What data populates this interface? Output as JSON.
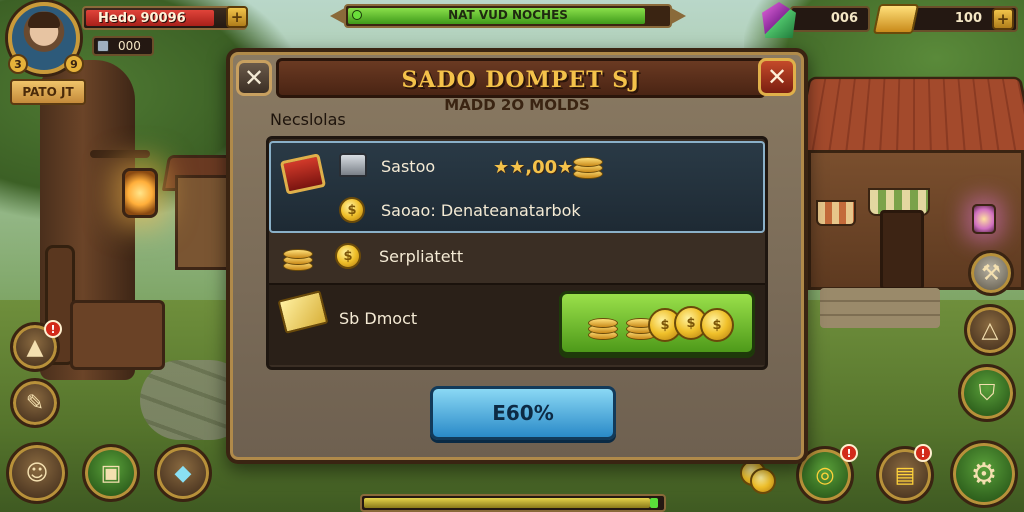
{
  "hud": {
    "player_name": "Hedo 90096",
    "player_bar_fill": 0.82,
    "player_level_left": "3",
    "player_level_right": "9",
    "gems_small": "000",
    "rank_label": "PATO JT",
    "title": "NAT VUD NOCHES",
    "title_progress": 0.93,
    "gems": "006",
    "gold": "100"
  },
  "modal": {
    "title": "SADO DOMPET SJ",
    "subtitle": "MADD 2O MOLDS",
    "section_label": "Necslolas",
    "rows": [
      {
        "name": "Sastoo",
        "price": "★★,00★"
      },
      {
        "name": "Saoao: Denateanatarbok"
      },
      {
        "name": "Serpliatett"
      },
      {
        "name": "Sb Dmoct"
      }
    ],
    "confirm_label": "E60%"
  },
  "bottom": {
    "progress": 0.96
  },
  "badges": {
    "quest_notif": "!",
    "inventory_notif": "!",
    "shop_notif": "!"
  },
  "colors": {
    "accent_gold": "#f4c24a",
    "buy_green": "#4e9a1a",
    "confirm_blue": "#2a8ac8",
    "close_red": "#c44a2a"
  },
  "icons": [
    "avatar",
    "gem-icon",
    "gold-bar-icon",
    "chest-icon",
    "anvil-icon",
    "coin-icon",
    "cash-icon",
    "gear-icon",
    "helmet-icon",
    "hammer-icon",
    "shield-icon",
    "crystal-icon"
  ]
}
